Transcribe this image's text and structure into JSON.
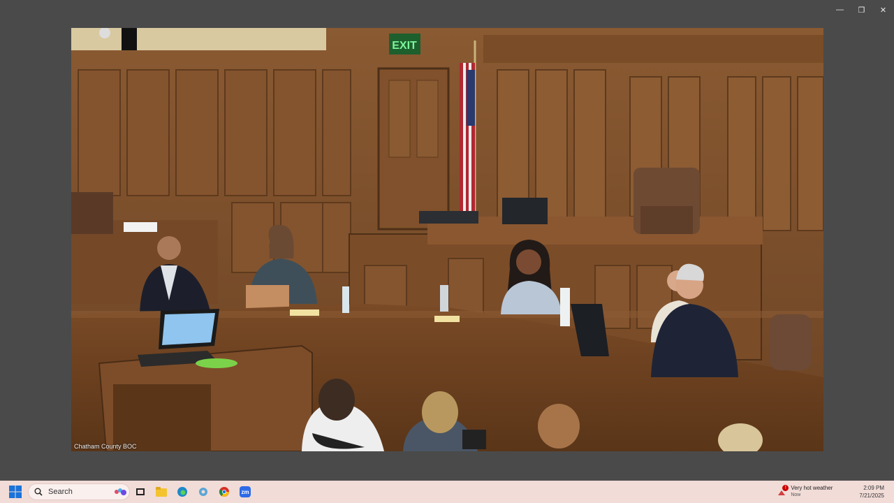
{
  "window": {
    "minimize_glyph": "—",
    "restore_glyph": "❐",
    "close_glyph": "✕"
  },
  "video": {
    "caption": "Chatham County BOC",
    "exit_sign": "EXIT"
  },
  "taskbar": {
    "search_placeholder": "Search",
    "apps": [
      "start-icon",
      "search-icon",
      "copilot-icon",
      "task-view-icon",
      "file-explorer-icon",
      "edge-icon",
      "settings-icon",
      "chrome-icon",
      "zoom-icon"
    ],
    "zoom_label": "zm",
    "weather": {
      "title": "Very hot weather",
      "subtitle": "Now",
      "alert_badge": "!"
    },
    "clock": {
      "time": "2:09 PM",
      "date": "7/21/2025"
    }
  },
  "colors": {
    "desktop_bg": "#4a4a4a",
    "taskbar_bg": "#f1dcd8",
    "wood": "#7a4f2c",
    "exit_green": "#3cdc6a"
  }
}
